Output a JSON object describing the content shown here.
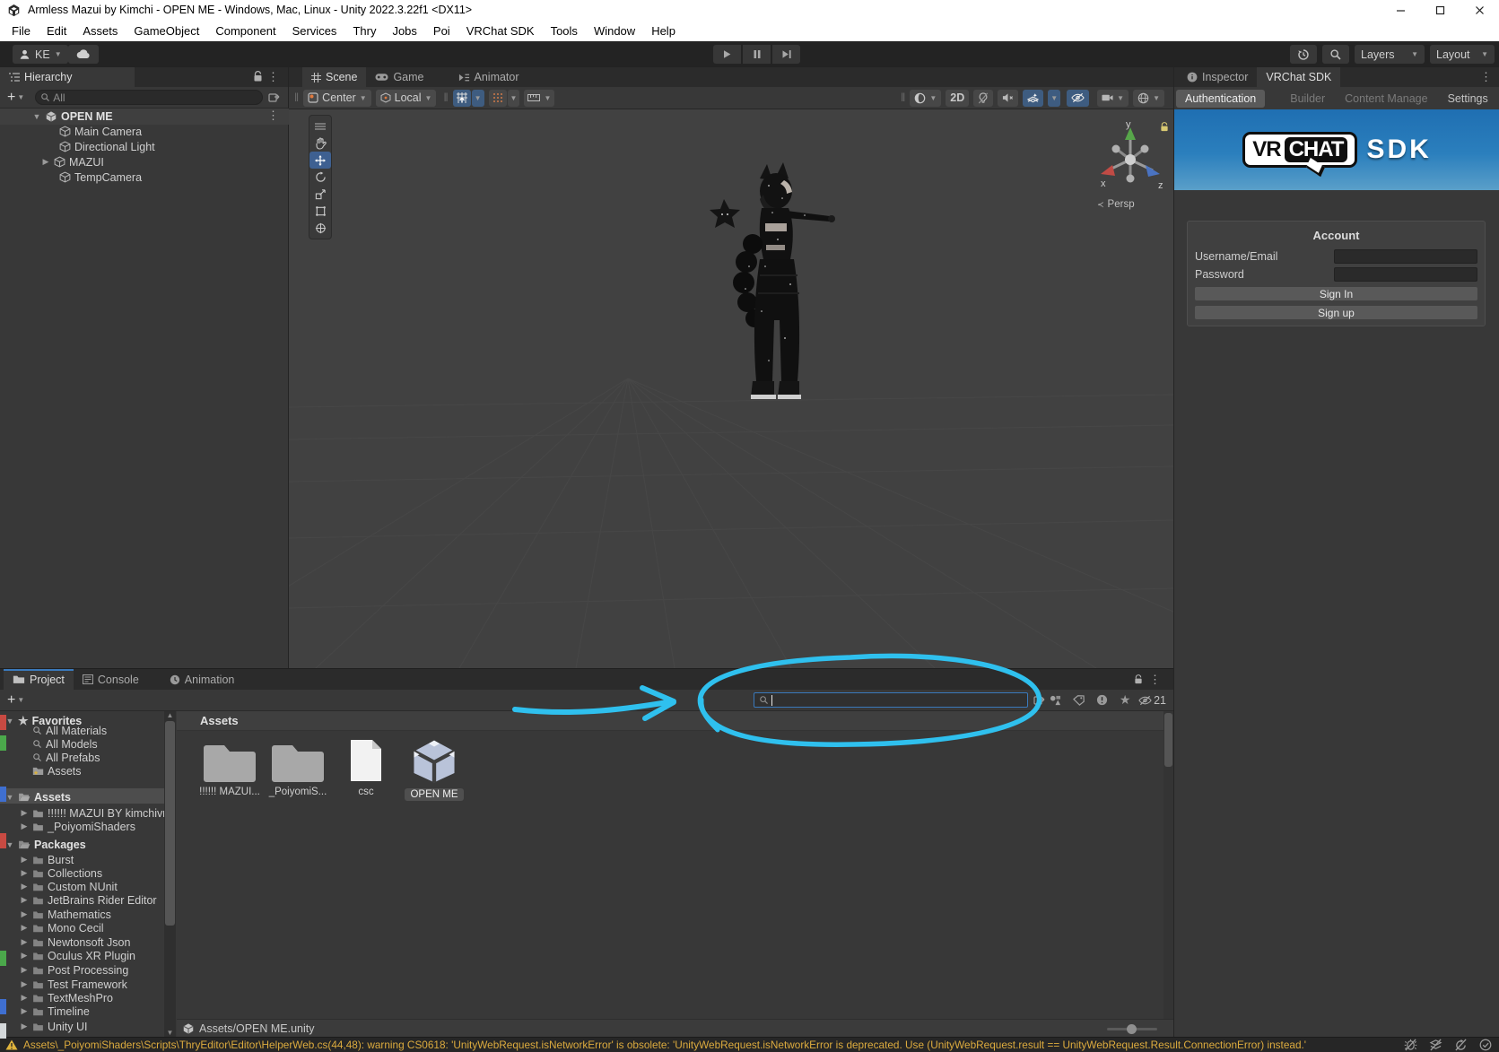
{
  "window": {
    "title": "Armless Mazui by Kimchi - OPEN ME - Windows, Mac, Linux - Unity 2022.3.22f1 <DX11>"
  },
  "menu": {
    "items": [
      "File",
      "Edit",
      "Assets",
      "GameObject",
      "Component",
      "Services",
      "Thry",
      "Jobs",
      "Poi",
      "VRChat SDK",
      "Tools",
      "Window",
      "Help"
    ]
  },
  "toolbar": {
    "account_label": "KE",
    "layers_label": "Layers",
    "layout_label": "Layout"
  },
  "hierarchy": {
    "tab": "Hierarchy",
    "search_placeholder": "All",
    "scene": "OPEN ME",
    "items": [
      "Main Camera",
      "Directional Light",
      "MAZUI",
      "TempCamera"
    ]
  },
  "scene": {
    "tabs": [
      "Scene",
      "Game",
      "Animator"
    ],
    "pivot": "Center",
    "space": "Local",
    "mode2d": "2D",
    "persp": "Persp",
    "axes": {
      "x": "x",
      "y": "y",
      "z": "z"
    }
  },
  "inspector": {
    "tabs": [
      "Inspector",
      "VRChat SDK"
    ],
    "subtabs": [
      "Authentication",
      "Builder",
      "Content Manage",
      "Settings"
    ],
    "logo": {
      "vr": "VR",
      "chat": "CHAT",
      "sdk": "SDK"
    },
    "account": {
      "title": "Account",
      "username_label": "Username/Email",
      "password_label": "Password",
      "sign_in": "Sign In",
      "sign_up": "Sign up"
    }
  },
  "project": {
    "tabs": [
      "Project",
      "Console",
      "Animation"
    ],
    "favorites_label": "Favorites",
    "favorites": [
      "All Materials",
      "All Models",
      "All Prefabs",
      "Assets"
    ],
    "assets_label": "Assets",
    "assets_children": [
      "!!!!!! MAZUI BY kimchivr",
      "_PoiyomiShaders"
    ],
    "packages_label": "Packages",
    "packages": [
      "Burst",
      "Collections",
      "Custom NUnit",
      "JetBrains Rider Editor",
      "Mathematics",
      "Mono Cecil",
      "Newtonsoft Json",
      "Oculus XR Plugin",
      "Post Processing",
      "Test Framework",
      "TextMeshPro",
      "Timeline",
      "Unity UI"
    ],
    "pane_header": "Assets",
    "tiles": [
      {
        "label": "!!!!!! MAZUI...",
        "type": "folder"
      },
      {
        "label": "_PoiyomiS...",
        "type": "folder"
      },
      {
        "label": "csc",
        "type": "file"
      },
      {
        "label": "OPEN ME",
        "type": "unity-scene"
      }
    ],
    "breadcrumb": "Assets/OPEN ME.unity",
    "hidden_count": "21"
  },
  "status": {
    "warning": "Assets\\_PoiyomiShaders\\Scripts\\ThryEditor\\Editor\\HelperWeb.cs(44,48): warning CS0618: 'UnityWebRequest.isNetworkError' is obsolete: 'UnityWebRequest.isNetworkError is deprecated. Use (UnityWebRequest.result == UnityWebRequest.Result.ConnectionError) instead.'"
  },
  "colors": {
    "accent_blue": "#3a79bb",
    "annotation": "#2fc0ee",
    "warning_text": "#dcab3e",
    "banner_top": "#1f6fb2",
    "banner_bottom": "#5a9fc9",
    "active_tool": "#3e6091"
  }
}
